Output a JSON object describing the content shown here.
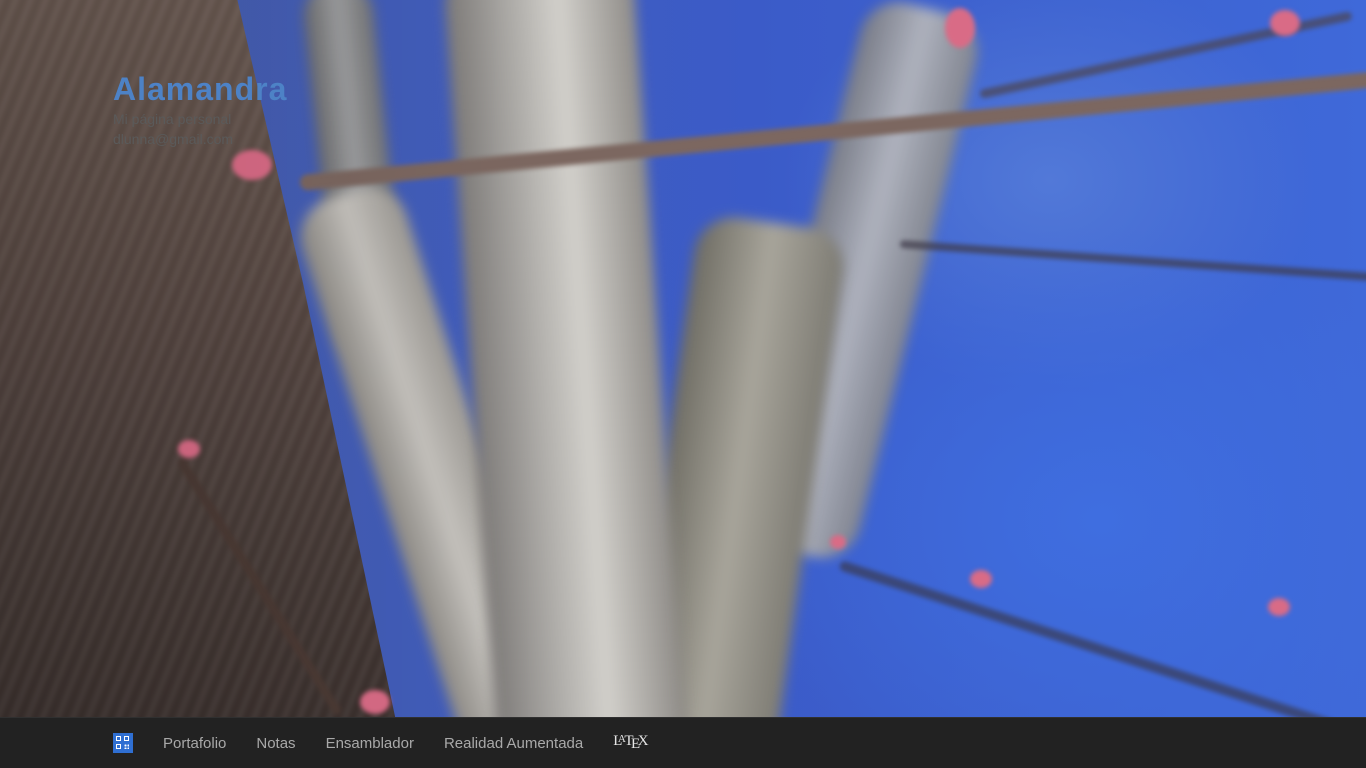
{
  "header": {
    "title": "Alamandra",
    "subtitle": "Mi página personal",
    "email": "dlunna@gmail.com"
  },
  "nav": {
    "home_icon": "grid-home-icon",
    "items": [
      {
        "label": "Portafolio"
      },
      {
        "label": "Notas"
      },
      {
        "label": "Ensamblador"
      },
      {
        "label": "Realidad Aumentada"
      }
    ],
    "latex": {
      "l": "L",
      "a": "A",
      "t": "T",
      "e": "E",
      "x": "X"
    }
  },
  "colors": {
    "title": "#4d82c6",
    "navbar_bg": "#222222",
    "nav_link": "#a9a9a9",
    "home_icon_bg": "#2f6fd2"
  }
}
